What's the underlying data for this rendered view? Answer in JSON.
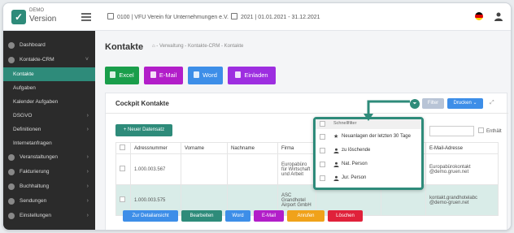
{
  "colors": {
    "accent": "#2e8b7a",
    "sidebar_bg": "#2b2b2b",
    "excel": "#1a9e4b",
    "email": "#b21ec9",
    "word": "#3d8ee8",
    "einladen": "#9d2ee0"
  },
  "header": {
    "logo_demo": "DEMO",
    "logo_version": "Version",
    "company": "0100 | VFU Verein für Unternehmungen e.V.",
    "period": "2021 | 01.01.2021 - 31.12.2021"
  },
  "sidebar": {
    "items": [
      {
        "label": "Dashboard",
        "icon": "dashboard-icon"
      },
      {
        "label": "Kontakte-CRM",
        "icon": "contacts-icon",
        "chevron": "˅"
      },
      {
        "label": "Kontakte",
        "active": true
      },
      {
        "label": "Aufgaben"
      },
      {
        "label": "Kalender Aufgaben"
      },
      {
        "label": "DSGVO",
        "chevron": "›"
      },
      {
        "label": "Definitionen",
        "chevron": "›"
      },
      {
        "label": "Internetanfragen"
      },
      {
        "label": "Veranstaltungen",
        "icon": "calendar-icon",
        "chevron": "›"
      },
      {
        "label": "Fakturierung",
        "icon": "invoice-icon",
        "chevron": "›"
      },
      {
        "label": "Buchhaltung",
        "icon": "accounting-icon",
        "chevron": "›"
      },
      {
        "label": "Sendungen",
        "icon": "mail-icon",
        "chevron": "›"
      },
      {
        "label": "Einstellungen",
        "icon": "settings-icon",
        "chevron": "›"
      }
    ]
  },
  "main": {
    "title": "Kontakte",
    "breadcrumb": "⌂  -  Verwaltung - Kontakte-CRM - Kontakte",
    "actions": {
      "excel": "Excel",
      "email": "E-Mail",
      "word": "Word",
      "einladen": "Einladen"
    },
    "panel": {
      "title": "Cockpit Kontakte",
      "filter_label": "Filter",
      "drucken_label": "Drucken ⌄",
      "new_record": "+ Neuer Datensatz",
      "enthalt": "Enthält"
    },
    "table": {
      "headers": [
        "",
        "Adressnummer",
        "Vorname",
        "Nachname",
        "Firma",
        "",
        "",
        "E-Mail-Adresse"
      ],
      "rows": [
        {
          "nr": "1.000.003.567",
          "vorname": "",
          "nachname": "",
          "firma": "Europabüro für Wirtschaft und Arbeit",
          "email": "Europabürokontakt @demo.gruen.net"
        },
        {
          "nr": "1.000.003.575",
          "vorname": "",
          "nachname": "",
          "firma": "ASC Grandhotel Airport GmbH",
          "email": "kontakt.grandhotelabc @demo-gruen.net"
        }
      ]
    },
    "row_actions": {
      "detail": "Zur Detailansicht",
      "edit": "Bearbeiten",
      "word": "Word",
      "email": "E-Mail",
      "call": "Anrufen",
      "delete": "Löschen"
    },
    "quickfilter": {
      "header": "Schnellfilter",
      "items": [
        {
          "label": "Neuanlagen der letzten 30 Tage",
          "icon": "star-icon"
        },
        {
          "label": "zu löschende",
          "icon": "user-icon"
        },
        {
          "label": "Nat. Person",
          "icon": "user-icon"
        },
        {
          "label": "Jur. Person",
          "icon": "user-icon"
        }
      ]
    }
  }
}
